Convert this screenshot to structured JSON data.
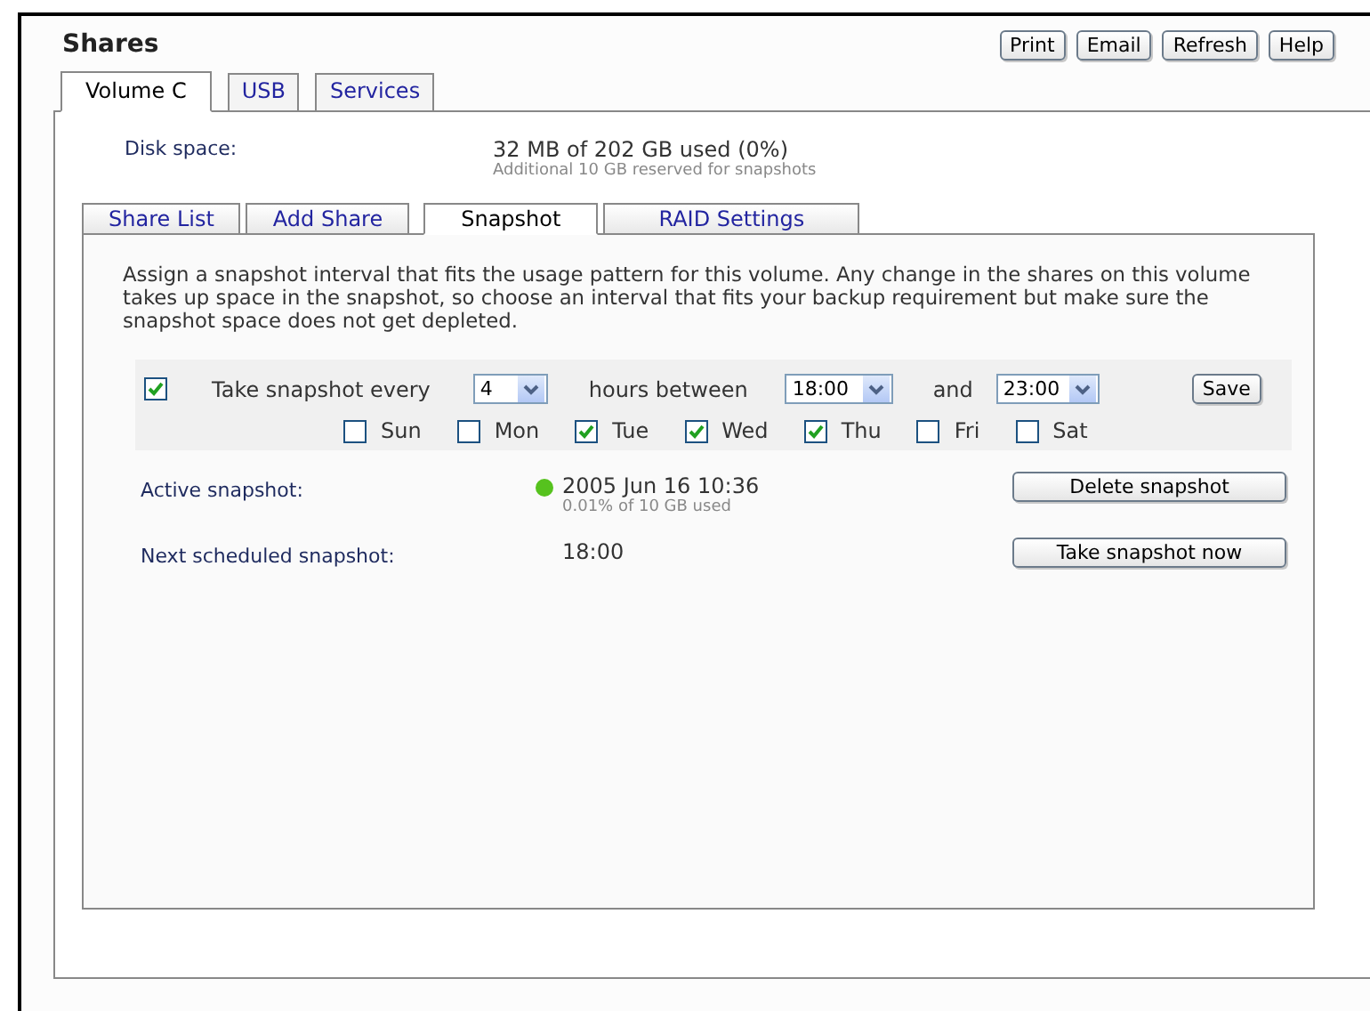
{
  "header": {
    "title": "Shares",
    "buttons": [
      "Print",
      "Email",
      "Refresh",
      "Help"
    ]
  },
  "volume_tabs": [
    {
      "label": "Volume C",
      "selected": true
    },
    {
      "label": "USB",
      "selected": false
    },
    {
      "label": "Services",
      "selected": false
    }
  ],
  "disk_space": {
    "label": "Disk space:",
    "value": "32 MB of 202 GB used (0%)",
    "note": "Additional 10 GB reserved for snapshots"
  },
  "tabs": [
    {
      "label": "Share List",
      "selected": false
    },
    {
      "label": "Add Share",
      "selected": false
    },
    {
      "label": "Snapshot",
      "selected": true
    },
    {
      "label": "RAID Settings",
      "selected": false
    }
  ],
  "description": "Assign a snapshot interval that fits the usage pattern for this volume. Any change in the shares on this volume takes up space in the snapshot, so choose an interval that fits your backup requirement but make sure the snapshot space does not get depleted.",
  "schedule": {
    "enabled": true,
    "label": "Take snapshot every",
    "interval": "4",
    "hours_label": "hours between",
    "start": "18:00",
    "and_label": "and",
    "end": "23:00",
    "save": "Save",
    "days": [
      {
        "label": "Sun",
        "checked": false
      },
      {
        "label": "Mon",
        "checked": false
      },
      {
        "label": "Tue",
        "checked": true
      },
      {
        "label": "Wed",
        "checked": true
      },
      {
        "label": "Thu",
        "checked": true
      },
      {
        "label": "Fri",
        "checked": false
      },
      {
        "label": "Sat",
        "checked": false
      }
    ]
  },
  "active_snapshot": {
    "label": "Active snapshot:",
    "color": "#56c21e",
    "value": "2005 Jun 16 10:36",
    "note": "0.01% of 10 GB used",
    "button": "Delete snapshot"
  },
  "next_snapshot": {
    "label": "Next scheduled snapshot:",
    "value": "18:00",
    "button": "Take snapshot now"
  }
}
